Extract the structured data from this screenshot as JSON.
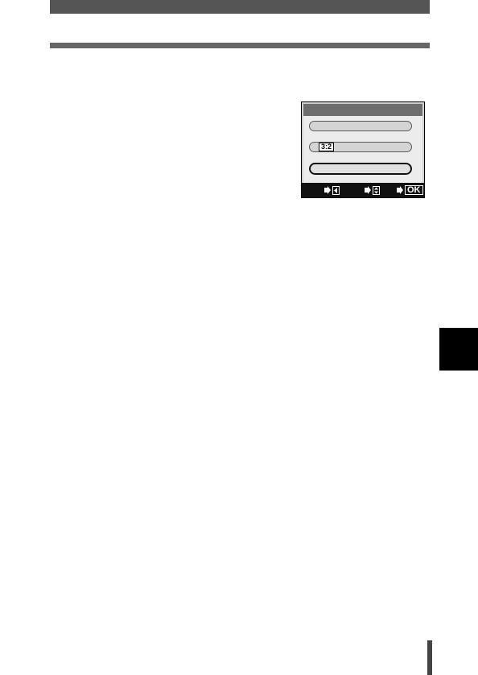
{
  "menu_screen": {
    "aspect_badge": "3:2",
    "footer": {
      "back_icon": "left-arrow-key-icon",
      "select_icon": "up-down-arrow-key-icon",
      "ok_label": "OK"
    }
  },
  "colors": {
    "header_bar": "#555555",
    "header_rule": "#666666",
    "side_tab": "#000000",
    "lcd_footer": "#111111"
  }
}
